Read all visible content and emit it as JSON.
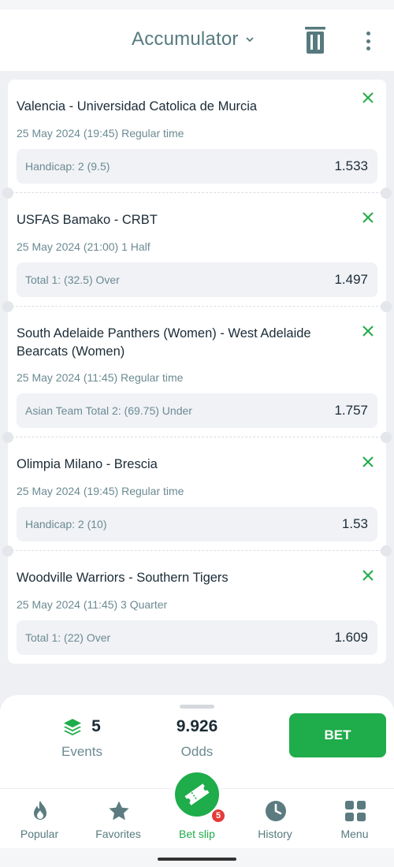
{
  "header": {
    "title": "Accumulator",
    "icons": [
      "chevron-down-icon",
      "trash-icon",
      "kebab-menu-icon"
    ]
  },
  "bets": [
    {
      "teams": "Valencia - Universidad Catolica de Murcia",
      "meta": "25 May 2024 (19:45) Regular time",
      "bet": "Handicap: 2 (9.5)",
      "odds": "1.533"
    },
    {
      "teams": "USFAS Bamako - CRBT",
      "meta": "25 May 2024 (21:00) 1 Half",
      "bet": "Total 1: (32.5) Over",
      "odds": "1.497"
    },
    {
      "teams": "South Adelaide Panthers (Women) - West Adelaide Bearcats (Women)",
      "meta": "25 May 2024 (11:45) Regular time",
      "bet": "Asian Team Total 2: (69.75) Under",
      "odds": "1.757"
    },
    {
      "teams": "Olimpia Milano - Brescia",
      "meta": "25 May 2024 (19:45) Regular time",
      "bet": "Handicap: 2 (10)",
      "odds": "1.53"
    },
    {
      "teams": "Woodville Warriors - Southern Tigers",
      "meta": "25 May 2024 (11:45) 3 Quarter",
      "bet": "Total 1: (22) Over",
      "odds": "1.609"
    }
  ],
  "summary": {
    "events_count": "5",
    "events_label": "Events",
    "odds_value": "9.926",
    "odds_label": "Odds",
    "bet_button": "BET"
  },
  "nav": {
    "items": [
      {
        "label": "Popular",
        "icon": "flame-icon"
      },
      {
        "label": "Favorites",
        "icon": "star-icon"
      },
      {
        "label": "Bet slip",
        "icon": "ticket-icon"
      },
      {
        "label": "History",
        "icon": "clock-icon"
      },
      {
        "label": "Menu",
        "icon": "grid-icon"
      }
    ],
    "badge": "5"
  },
  "colors": {
    "accent": "#1fac4a",
    "title": "#567a7e",
    "badge": "#e63a3a"
  }
}
